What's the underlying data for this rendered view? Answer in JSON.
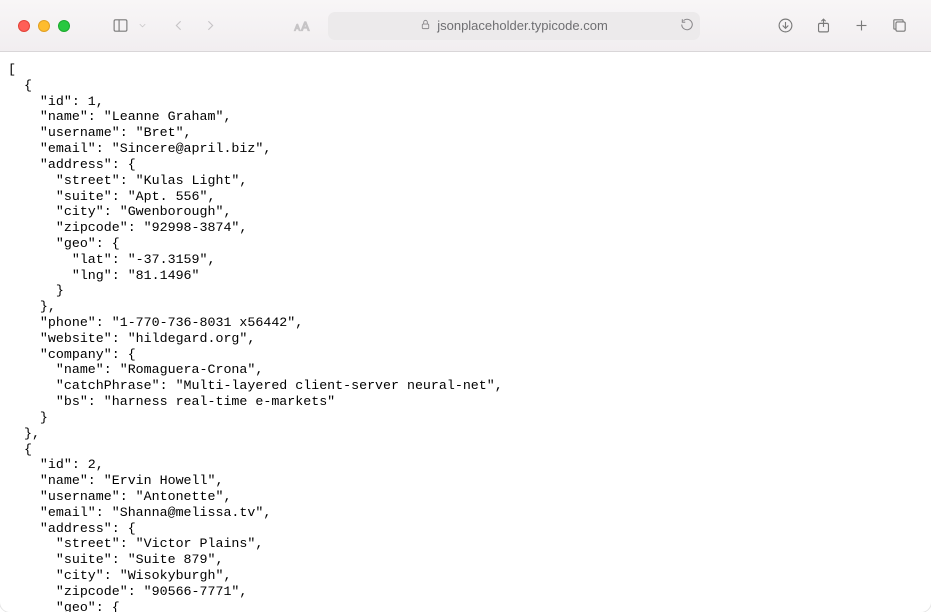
{
  "urlbar": {
    "domain": "jsonplaceholder.typicode.com"
  },
  "json_text": "[\n  {\n    \"id\": 1,\n    \"name\": \"Leanne Graham\",\n    \"username\": \"Bret\",\n    \"email\": \"Sincere@april.biz\",\n    \"address\": {\n      \"street\": \"Kulas Light\",\n      \"suite\": \"Apt. 556\",\n      \"city\": \"Gwenborough\",\n      \"zipcode\": \"92998-3874\",\n      \"geo\": {\n        \"lat\": \"-37.3159\",\n        \"lng\": \"81.1496\"\n      }\n    },\n    \"phone\": \"1-770-736-8031 x56442\",\n    \"website\": \"hildegard.org\",\n    \"company\": {\n      \"name\": \"Romaguera-Crona\",\n      \"catchPhrase\": \"Multi-layered client-server neural-net\",\n      \"bs\": \"harness real-time e-markets\"\n    }\n  },\n  {\n    \"id\": 2,\n    \"name\": \"Ervin Howell\",\n    \"username\": \"Antonette\",\n    \"email\": \"Shanna@melissa.tv\",\n    \"address\": {\n      \"street\": \"Victor Plains\",\n      \"suite\": \"Suite 879\",\n      \"city\": \"Wisokyburgh\",\n      \"zipcode\": \"90566-7771\",\n      \"geo\": {"
}
